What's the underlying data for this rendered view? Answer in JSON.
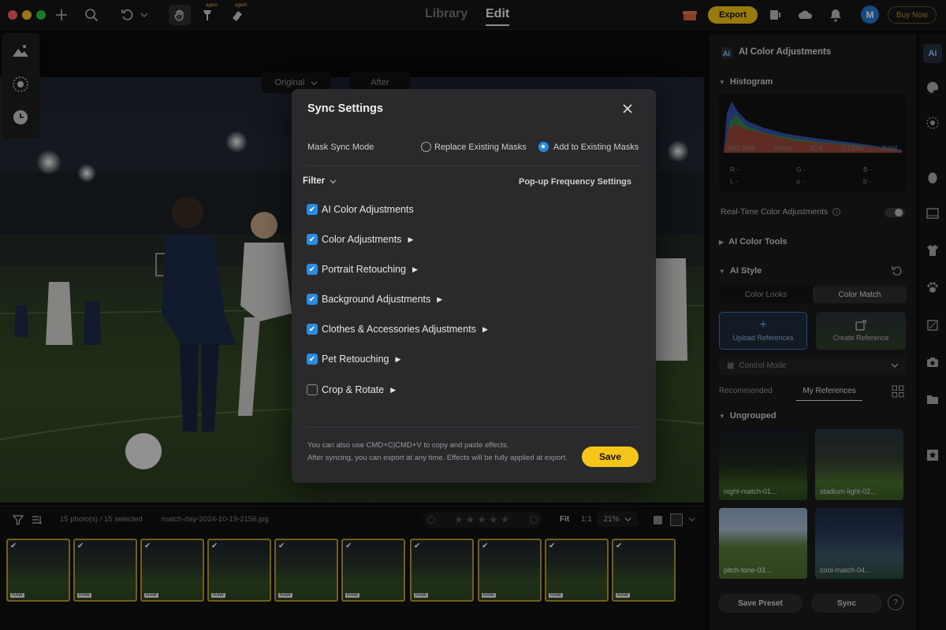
{
  "topbar": {
    "tab_library": "Library",
    "tab_edit": "Edit",
    "export_label": "Export",
    "avatar_initial": "M",
    "buy_now": "Buy Now",
    "agent_badge_1": "agent",
    "agent_badge_2": "agent"
  },
  "compare": {
    "original": "Original",
    "after": "After"
  },
  "modal": {
    "title": "Sync Settings",
    "mask_sync_mode_label": "Mask Sync Mode",
    "radio_replace": "Replace Existing Masks",
    "radio_add": "Add to Existing Masks",
    "selected_mode": "Add to Existing Masks",
    "filter_label": "Filter",
    "popup_freq": "Pop-up Frequency Settings",
    "items": [
      {
        "label": "AI Color Adjustments",
        "checked": true,
        "expandable": false
      },
      {
        "label": "Color Adjustments",
        "checked": true,
        "expandable": true
      },
      {
        "label": "Portrait Retouching",
        "checked": true,
        "expandable": true
      },
      {
        "label": "Background Adjustments",
        "checked": true,
        "expandable": true
      },
      {
        "label": "Clothes & Accessories Adjustments",
        "checked": true,
        "expandable": true
      },
      {
        "label": "Pet Retouching",
        "checked": true,
        "expandable": true
      },
      {
        "label": "Crop & Rotate",
        "checked": false,
        "expandable": true
      }
    ],
    "hint_1": "You can also use CMD+C|CMD+V to copy and paste effects.",
    "hint_2": "After syncing, you can export at any time. Effects will be fully applied at export.",
    "save_label": "Save"
  },
  "filmstrip": {
    "count": "15 photo(s) / 15 selected",
    "filename": "match-day-2024-10-19-2156.jpg",
    "fit": "Fit",
    "one_to_one": "1:1",
    "zoom": "21%",
    "rating_stars": 0,
    "raw_badge": "RAW"
  },
  "panel": {
    "header": "AI Color Adjustments",
    "histogram_title": "Histogram",
    "exif": {
      "iso": "ISO 1600",
      "focal": "45mm",
      "aperture": "f/2.8",
      "shutter": "1/1000s",
      "format": "RAW"
    },
    "rgb": {
      "r": "R -",
      "g": "G -",
      "b": "B -",
      "l": "L -",
      "a": "a -",
      "b2": "b -"
    },
    "realtime_label": "Real-Time Color Adjustments",
    "ai_color_tools": "AI Color Tools",
    "ai_style": "AI Style",
    "tab_color_looks": "Color Looks",
    "tab_color_match": "Color Match",
    "upload_refs": "Upload References",
    "create_ref": "Create Reference",
    "control_mode": "Control Mode",
    "tab_recommended": "Recommended",
    "tab_my_refs": "My References",
    "ungrouped": "Ungrouped",
    "refs": [
      "night-match-01...",
      "stadium-light-02...",
      "pitch-tone-03...",
      "cool-match-04..."
    ],
    "save_preset": "Save Preset",
    "sync": "Sync",
    "help": "?"
  },
  "colors": {
    "accent_yellow": "#f5c518",
    "checkbox_blue": "#2b8be0",
    "thumb_border": "#b89a2a"
  }
}
